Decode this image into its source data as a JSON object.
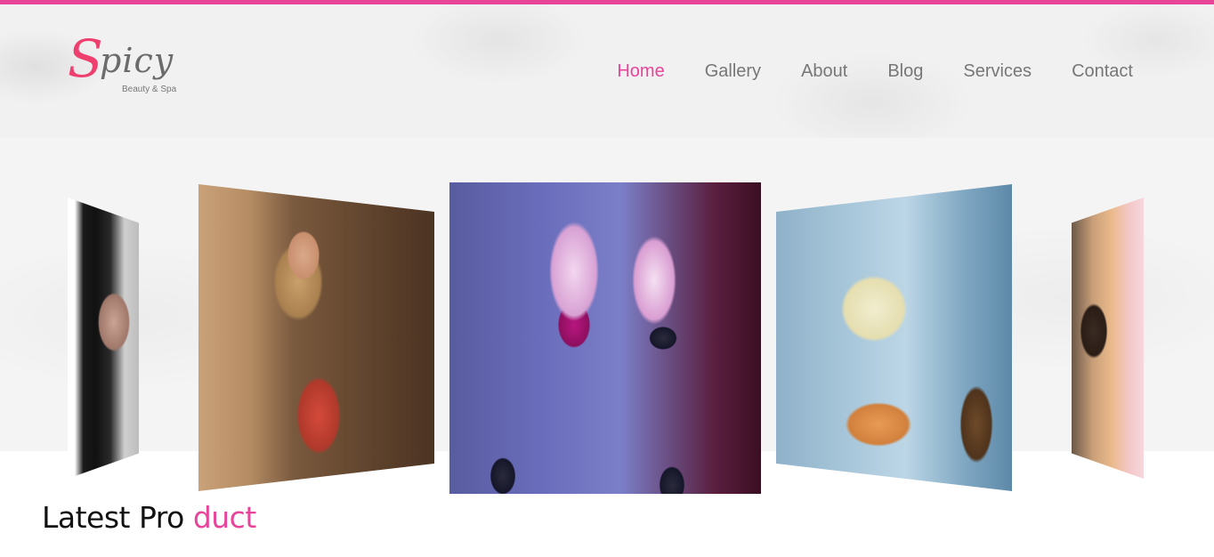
{
  "colors": {
    "accent": "#e8449a",
    "logo_red": "#ee3f6e",
    "nav_text": "#777777"
  },
  "logo": {
    "initial": "S",
    "name": "picy",
    "tagline": "Beauty & Spa"
  },
  "nav": {
    "items": [
      "Home",
      "Gallery",
      "About",
      "Blog",
      "Services",
      "Contact"
    ],
    "active": "Home"
  },
  "carousel": {
    "slides": [
      {
        "name": "woman-dark-hair"
      },
      {
        "name": "woman-wooden-door"
      },
      {
        "name": "orchids-and-stones"
      },
      {
        "name": "orchids-and-candles"
      },
      {
        "name": "spa-massage"
      }
    ]
  },
  "section": {
    "title_part1": "Latest Pro ",
    "title_part2": "duct"
  }
}
